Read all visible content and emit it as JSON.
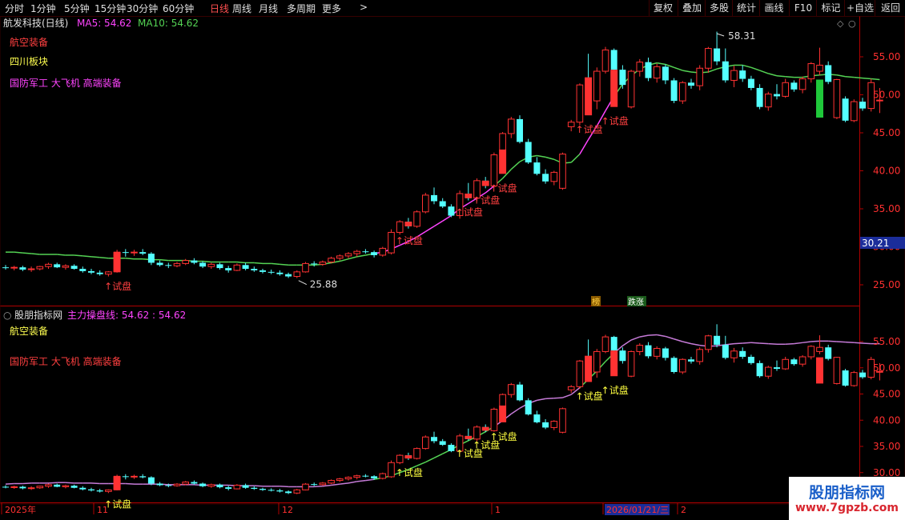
{
  "toolbar": {
    "periods": [
      "分时",
      "1分钟",
      "5分钟",
      "15分钟",
      "30分钟",
      "60分钟",
      "日线",
      "周线",
      "月线",
      "多周期",
      "更多"
    ],
    "active_period": "日线",
    "more_arrow": ">",
    "right_buttons": [
      "复权",
      "叠加",
      "多股",
      "统计",
      "画线",
      "F10",
      "标记",
      "+自选",
      "返回"
    ]
  },
  "colors": {
    "up": "#ff3232",
    "down": "#54ffff",
    "ma_high": "#ff44ff",
    "ma_up": "#54d354",
    "ma_low": "#8844ff",
    "axis": "#b00000"
  },
  "main_panel": {
    "title": "航发科技(日线)",
    "ma5_label": "MA5: 54.62",
    "ma10_label": "MA10: 54.62",
    "notes": [
      "航空装备",
      "四川板块",
      "国防军工 大飞机 高端装备"
    ],
    "high_label": "58.31",
    "low_label": "25.88",
    "current_price": "30.21",
    "yticks": [
      "55.00",
      "50.00",
      "45.00",
      "40.00",
      "35.00",
      "30.00",
      "25.00"
    ],
    "badges": [
      "榜",
      "跌涨"
    ]
  },
  "sub_panel": {
    "title": "股朋指标网",
    "indicator_label": "主力操盘线: 54.62 : 54.62",
    "notes": [
      "航空装备",
      "国防军工 大飞机 高端装备"
    ],
    "yticks": [
      "55.00",
      "50.00",
      "45.00",
      "40.00",
      "35.00",
      "30.00"
    ]
  },
  "signal_label": "试盘",
  "x_axis": {
    "labels": [
      "2025年",
      "11",
      "12",
      "1",
      "2026/01/21/三",
      "2"
    ]
  },
  "watermark": {
    "name": "股朋指标网",
    "url": "www.7gpzb.com"
  },
  "chart_data": {
    "type": "candlestick",
    "title": "航发科技(日线)",
    "ylim": [
      23,
      60
    ],
    "series_ma": "MA5 / MA10 / 主力操盘线",
    "ohlc": [
      [
        27.3,
        27.6,
        27.0,
        27.2
      ],
      [
        27.2,
        27.5,
        26.9,
        27.3
      ],
      [
        27.3,
        27.5,
        26.8,
        27.0
      ],
      [
        27.0,
        27.4,
        26.7,
        27.1
      ],
      [
        27.1,
        27.5,
        26.9,
        27.4
      ],
      [
        27.4,
        27.9,
        27.1,
        27.7
      ],
      [
        27.7,
        27.9,
        27.2,
        27.3
      ],
      [
        27.3,
        27.7,
        27.0,
        27.5
      ],
      [
        27.5,
        27.7,
        27.0,
        27.1
      ],
      [
        27.1,
        27.4,
        26.6,
        26.8
      ],
      [
        26.8,
        27.1,
        26.4,
        26.6
      ],
      [
        26.6,
        26.9,
        26.2,
        26.4
      ],
      [
        26.4,
        26.8,
        26.1,
        26.7
      ],
      [
        26.7,
        29.6,
        26.6,
        29.3
      ],
      [
        29.3,
        29.7,
        28.7,
        29.2
      ],
      [
        29.2,
        29.6,
        28.8,
        29.3
      ],
      [
        29.3,
        29.7,
        28.9,
        29.1
      ],
      [
        29.1,
        29.3,
        27.6,
        27.9
      ],
      [
        27.9,
        28.2,
        27.4,
        27.6
      ],
      [
        27.6,
        27.9,
        27.2,
        27.5
      ],
      [
        27.5,
        28.0,
        27.3,
        27.8
      ],
      [
        27.8,
        28.4,
        27.6,
        28.2
      ],
      [
        28.2,
        28.5,
        27.7,
        27.9
      ],
      [
        27.9,
        28.1,
        27.2,
        27.4
      ],
      [
        27.4,
        27.9,
        27.1,
        27.7
      ],
      [
        27.7,
        27.9,
        27.0,
        27.2
      ],
      [
        27.2,
        27.5,
        26.6,
        26.9
      ],
      [
        26.9,
        27.8,
        26.8,
        27.6
      ],
      [
        27.6,
        27.9,
        26.9,
        27.1
      ],
      [
        27.1,
        27.4,
        26.7,
        26.9
      ],
      [
        26.9,
        27.1,
        26.5,
        26.7
      ],
      [
        26.7,
        27.0,
        26.4,
        26.6
      ],
      [
        26.6,
        26.9,
        26.2,
        26.4
      ],
      [
        26.4,
        26.6,
        25.9,
        26.1
      ],
      [
        26.1,
        26.9,
        25.88,
        26.7
      ],
      [
        26.7,
        28.0,
        26.6,
        27.8
      ],
      [
        27.8,
        28.1,
        27.4,
        27.7
      ],
      [
        27.7,
        28.2,
        27.5,
        28.0
      ],
      [
        28.0,
        28.7,
        27.8,
        28.5
      ],
      [
        28.5,
        29.0,
        28.2,
        28.8
      ],
      [
        28.8,
        29.3,
        28.5,
        29.1
      ],
      [
        29.1,
        29.6,
        28.7,
        29.4
      ],
      [
        29.4,
        29.7,
        29.1,
        29.3
      ],
      [
        29.3,
        29.5,
        28.6,
        28.9
      ],
      [
        28.9,
        30.0,
        28.7,
        29.8
      ],
      [
        29.2,
        32.3,
        29.0,
        31.9
      ],
      [
        31.9,
        33.5,
        31.6,
        33.3
      ],
      [
        33.3,
        33.8,
        32.4,
        32.7
      ],
      [
        32.7,
        34.8,
        32.5,
        34.6
      ],
      [
        34.6,
        37.1,
        34.4,
        36.8
      ],
      [
        36.8,
        37.8,
        35.6,
        36.0
      ],
      [
        36.0,
        36.4,
        35.1,
        35.3
      ],
      [
        35.3,
        35.6,
        33.9,
        34.1
      ],
      [
        34.1,
        37.4,
        33.7,
        37.0
      ],
      [
        37.0,
        38.4,
        36.1,
        36.4
      ],
      [
        36.4,
        39.0,
        36.0,
        38.7
      ],
      [
        38.7,
        39.2,
        37.7,
        38.0
      ],
      [
        38.0,
        42.4,
        37.8,
        42.1
      ],
      [
        42.1,
        45.1,
        41.8,
        44.9
      ],
      [
        44.9,
        47.1,
        44.3,
        46.8
      ],
      [
        46.8,
        47.3,
        43.6,
        43.8
      ],
      [
        43.8,
        44.2,
        40.9,
        41.1
      ],
      [
        41.1,
        41.8,
        39.4,
        39.6
      ],
      [
        39.6,
        40.2,
        38.3,
        38.6
      ],
      [
        38.6,
        40.0,
        38.1,
        39.8
      ],
      [
        37.7,
        42.4,
        37.5,
        42.2
      ],
      [
        45.8,
        46.7,
        45.2,
        46.4
      ],
      [
        46.4,
        51.5,
        46.0,
        51.3
      ],
      [
        51.3,
        55.4,
        48.9,
        49.2
      ],
      [
        49.2,
        53.6,
        48.1,
        53.1
      ],
      [
        53.1,
        56.3,
        52.8,
        55.9
      ],
      [
        55.9,
        56.1,
        52.8,
        53.3
      ],
      [
        53.3,
        53.9,
        50.8,
        51.3
      ],
      [
        48.4,
        53.3,
        48.2,
        53.1
      ],
      [
        53.1,
        54.7,
        52.4,
        54.3
      ],
      [
        54.3,
        54.9,
        51.8,
        52.2
      ],
      [
        52.2,
        54.1,
        51.6,
        53.7
      ],
      [
        53.7,
        54.0,
        51.4,
        51.9
      ],
      [
        51.9,
        52.2,
        48.9,
        49.2
      ],
      [
        49.2,
        51.8,
        48.8,
        51.6
      ],
      [
        51.6,
        52.1,
        50.8,
        51.2
      ],
      [
        51.2,
        53.9,
        50.6,
        53.5
      ],
      [
        53.5,
        56.3,
        52.9,
        56.1
      ],
      [
        56.1,
        58.31,
        53.9,
        54.4
      ],
      [
        54.4,
        56.1,
        51.6,
        51.9
      ],
      [
        51.9,
        53.8,
        51.0,
        53.2
      ],
      [
        53.2,
        53.9,
        51.7,
        52.1
      ],
      [
        52.1,
        52.5,
        50.6,
        50.9
      ],
      [
        50.9,
        51.4,
        48.1,
        48.4
      ],
      [
        48.4,
        50.4,
        47.9,
        50.1
      ],
      [
        50.1,
        51.4,
        49.4,
        49.8
      ],
      [
        49.8,
        52.1,
        49.6,
        51.6
      ],
      [
        51.6,
        51.9,
        50.4,
        50.7
      ],
      [
        50.7,
        52.4,
        50.2,
        52.1
      ],
      [
        52.1,
        54.3,
        51.6,
        54.1
      ],
      [
        53.1,
        56.2,
        52.6,
        53.9
      ],
      [
        53.9,
        54.4,
        51.4,
        51.7
      ],
      [
        47.0,
        52.1,
        46.8,
        52.0
      ],
      [
        49.5,
        49.8,
        46.4,
        46.6
      ],
      [
        46.6,
        49.4,
        46.4,
        49.1
      ],
      [
        49.1,
        49.6,
        47.9,
        48.2
      ],
      [
        48.2,
        52.1,
        47.8,
        51.6
      ],
      [
        49.2,
        50.9,
        47.6,
        49.3
      ]
    ],
    "ma_line_1": [
      29.3,
      29.3,
      29.2,
      29.1,
      29.0,
      29.0,
      29.0,
      28.9,
      28.9,
      28.8,
      28.7,
      28.6,
      28.5,
      28.5,
      28.5,
      28.4,
      28.4,
      28.3,
      28.3,
      28.2,
      28.2,
      28.2,
      28.1,
      28.1,
      28.0,
      28.0,
      28.0,
      28.0,
      27.9,
      27.9,
      27.8,
      27.8,
      27.7,
      27.6,
      27.6,
      27.6,
      27.6,
      27.7,
      27.9,
      28.1,
      28.4,
      28.7,
      28.9,
      29.1,
      29.3,
      29.7,
      30.2,
      30.7,
      31.3,
      32.0,
      32.7,
      33.4,
      34.1,
      35.0,
      35.7,
      36.4,
      37.1,
      38.0,
      39.0,
      40.2,
      41.2,
      41.8,
      42.0,
      41.8,
      41.5,
      41.0,
      41.1,
      42.2,
      44.1,
      45.9,
      47.9,
      49.8,
      51.4,
      52.5,
      53.4,
      53.9,
      54.2,
      54.0,
      53.6,
      53.2,
      53.0,
      52.9,
      53.0,
      53.4,
      53.7,
      53.9,
      53.9,
      53.6,
      53.2,
      52.8,
      52.5,
      52.4,
      52.3,
      52.3,
      52.5,
      52.6,
      52.7,
      52.6,
      52.4,
      52.3,
      52.2,
      52.1,
      52.0
    ],
    "ma_line_2": [
      27.8,
      27.9,
      27.9,
      28.0,
      28.0,
      28.0,
      28.1,
      28.1,
      28.0,
      28.0,
      28.0,
      27.9,
      27.9,
      27.9,
      27.9,
      27.8,
      27.8,
      27.8,
      27.8,
      27.7,
      27.7,
      27.7,
      27.7,
      27.6,
      27.6,
      27.6,
      27.6,
      27.5,
      27.5,
      27.5,
      27.4,
      27.4,
      27.4,
      27.3,
      27.3,
      27.3,
      27.3,
      27.4,
      27.6,
      27.8,
      28.0,
      28.3,
      28.5,
      28.7,
      29.0,
      29.4,
      30.0,
      30.6,
      31.3,
      32.0,
      32.8,
      33.6,
      34.4,
      35.3,
      36.1,
      36.9,
      37.8,
      38.8,
      39.9,
      41.2,
      42.3,
      43.2,
      43.8,
      44.1,
      44.2,
      44.3,
      44.9,
      46.2,
      47.8,
      49.4,
      51.2,
      52.8,
      54.2,
      55.3,
      55.9,
      56.2,
      56.3,
      56.0,
      55.5,
      55.0,
      54.6,
      54.3,
      54.1,
      54.2,
      54.4,
      54.6,
      54.7,
      54.8,
      54.7,
      54.6,
      54.5,
      54.5,
      54.6,
      54.8,
      55.0,
      55.1,
      55.1,
      55.0,
      54.9,
      54.8,
      54.7,
      54.6,
      54.6
    ]
  }
}
